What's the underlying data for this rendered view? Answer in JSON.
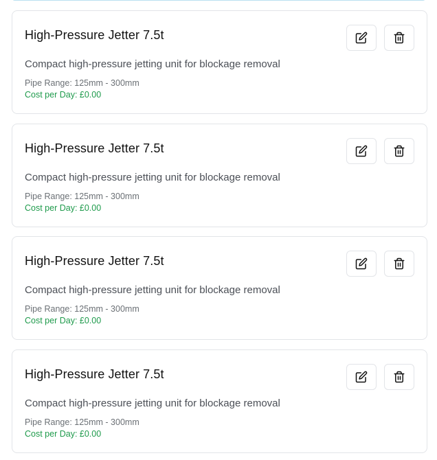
{
  "items": [
    {
      "title": "High-Pressure Jetter 7.5t",
      "description": "Compact high-pressure jetting unit for blockage removal",
      "pipe_range": "Pipe Range: 125mm - 300mm",
      "cost": "Cost per Day: £0.00",
      "edit_icon": "edit-icon",
      "delete_icon": "trash-icon"
    },
    {
      "title": "High-Pressure Jetter 7.5t",
      "description": "Compact high-pressure jetting unit for blockage removal",
      "pipe_range": "Pipe Range: 125mm - 300mm",
      "cost": "Cost per Day: £0.00",
      "edit_icon": "edit-icon",
      "delete_icon": "trash-icon"
    },
    {
      "title": "High-Pressure Jetter 7.5t",
      "description": "Compact high-pressure jetting unit for blockage removal",
      "pipe_range": "Pipe Range: 125mm - 300mm",
      "cost": "Cost per Day: £0.00",
      "edit_icon": "edit-icon",
      "delete_icon": "trash-icon"
    },
    {
      "title": "High-Pressure Jetter 7.5t",
      "description": "Compact high-pressure jetting unit for blockage removal",
      "pipe_range": "Pipe Range: 125mm - 300mm",
      "cost": "Cost per Day: £0.00",
      "edit_icon": "edit-icon",
      "delete_icon": "trash-icon"
    }
  ],
  "colors": {
    "cost_text": "#1e9a4b",
    "card_border": "#e2e4e8",
    "previous_card_border": "#b9e0f0"
  }
}
